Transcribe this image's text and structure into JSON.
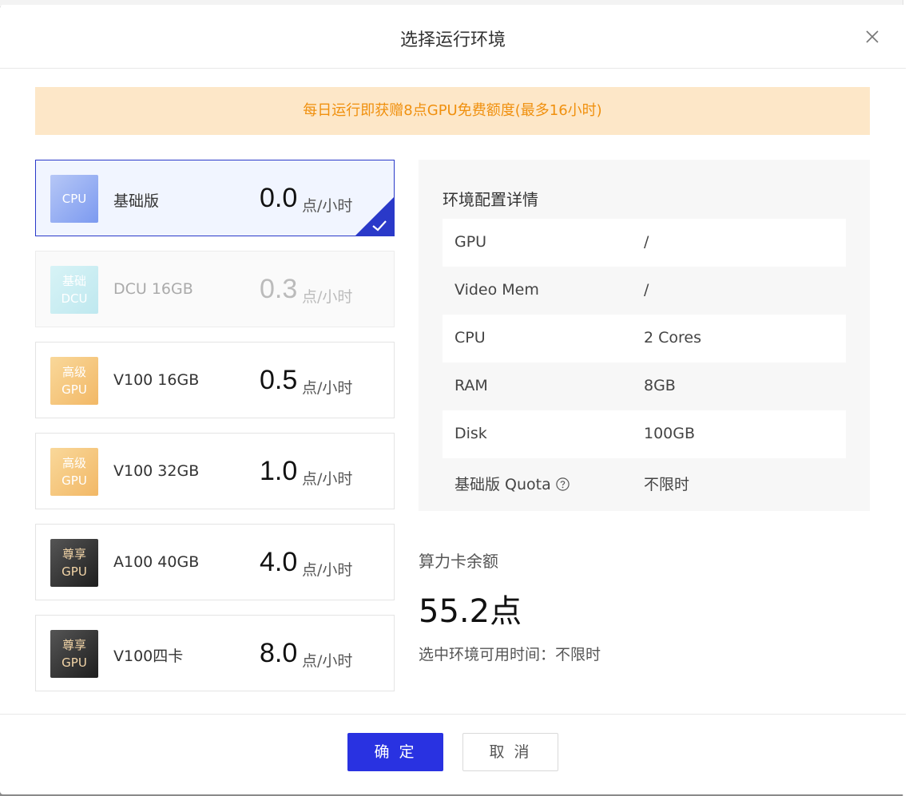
{
  "dialog": {
    "title": "选择运行环境",
    "close_icon": "close-icon"
  },
  "banner": {
    "text": "每日运行即获赠8点GPU免费额度(最多16小时)",
    "color": "#f0900e",
    "background": "#fde7c8"
  },
  "environments": [
    {
      "badge": [
        "CPU"
      ],
      "name": "基础版",
      "price": "0.0",
      "unit": "点/小时",
      "selected": true,
      "disabled": false
    },
    {
      "badge": [
        "基础",
        "DCU"
      ],
      "name": "DCU 16GB",
      "price": "0.3",
      "unit": "点/小时",
      "selected": false,
      "disabled": true
    },
    {
      "badge": [
        "高级",
        "GPU"
      ],
      "name": "V100 16GB",
      "price": "0.5",
      "unit": "点/小时",
      "selected": false,
      "disabled": false
    },
    {
      "badge": [
        "高级",
        "GPU"
      ],
      "name": "V100 32GB",
      "price": "1.0",
      "unit": "点/小时",
      "selected": false,
      "disabled": false
    },
    {
      "badge": [
        "尊享",
        "GPU"
      ],
      "name": "A100 40GB",
      "price": "4.0",
      "unit": "点/小时",
      "selected": false,
      "disabled": false
    },
    {
      "badge": [
        "尊享",
        "GPU"
      ],
      "name": "V100四卡",
      "price": "8.0",
      "unit": "点/小时",
      "selected": false,
      "disabled": false
    }
  ],
  "details": {
    "title": "环境配置详情",
    "rows": [
      {
        "key": "GPU",
        "value": "/"
      },
      {
        "key": "Video Mem",
        "value": "/"
      },
      {
        "key": "CPU",
        "value": "2 Cores"
      },
      {
        "key": "RAM",
        "value": "8GB"
      },
      {
        "key": "Disk",
        "value": "100GB"
      },
      {
        "key": "基础版 Quota",
        "value": "不限时"
      }
    ]
  },
  "balance": {
    "label": "算力卡余额",
    "value": "55.2点",
    "available": "选中环境可用时间：不限时"
  },
  "footer": {
    "ok_label": "确 定",
    "cancel_label": "取 消",
    "accent": "#2932e1"
  }
}
